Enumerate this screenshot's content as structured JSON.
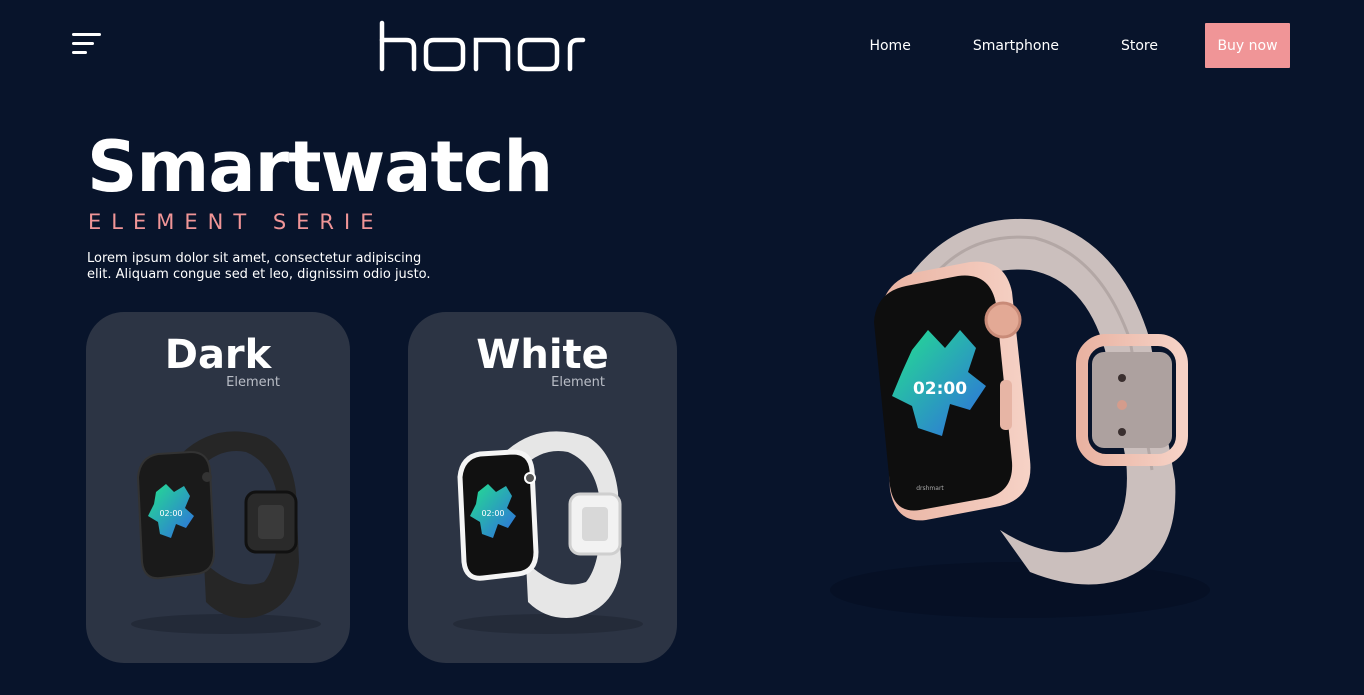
{
  "header": {
    "menu_icon": "hamburger-menu-icon",
    "logo_text": "honor",
    "nav": [
      {
        "label": "Home"
      },
      {
        "label": "Smartphone"
      },
      {
        "label": "Store"
      }
    ],
    "buy_button": "Buy now"
  },
  "hero": {
    "title": "Smartwatch",
    "subtitle": "ELEMENT SERIE",
    "description": "Lorem ipsum dolor sit amet, consectetur adipiscing elit. Aliquam congue sed et leo, dignissim odio justo."
  },
  "variants": [
    {
      "title": "Dark",
      "label": "Element"
    },
    {
      "title": "White",
      "label": "Element"
    }
  ],
  "watch_screen": {
    "time": "02:00",
    "brand": "drshmart"
  },
  "colors": {
    "background": "#08142b",
    "accent": "#f09597",
    "card": "#2c3444",
    "watch_screen_gradient_start": "#24e08f",
    "watch_screen_gradient_end": "#2f6be0"
  }
}
